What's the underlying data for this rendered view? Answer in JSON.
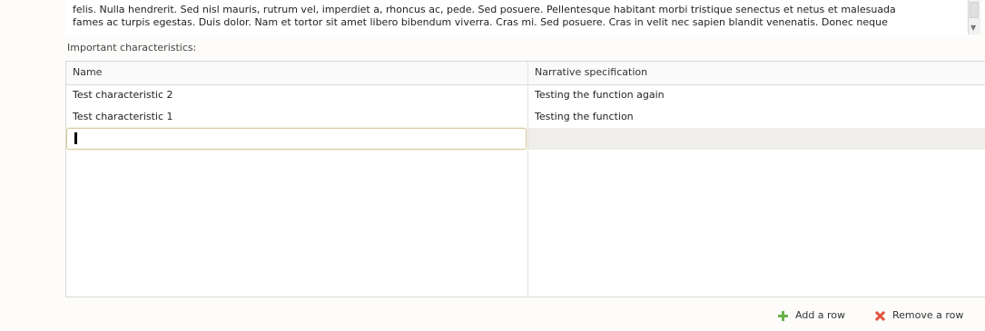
{
  "description": {
    "line1": "felis. Nulla hendrerit. Sed nisl mauris, rutrum vel, imperdiet a, rhoncus ac, pede. Sed posuere. Pellentesque habitant morbi tristique senectus et netus et malesuada",
    "line2": "fames ac turpis egestas. Duis dolor. Nam et tortor sit amet libero bibendum viverra. Cras mi. Sed posuere. Cras in velit nec sapien blandit venenatis. Donec neque",
    "scroll_arrow": "▼"
  },
  "characteristics": {
    "label": "Important characteristics:",
    "columns": [
      "Name",
      "Narrative specification"
    ],
    "rows": [
      {
        "name": "Test characteristic 2",
        "spec": "Testing the function again"
      },
      {
        "name": "Test characteristic 1",
        "spec": "Testing the function"
      }
    ],
    "new_row_value": ""
  },
  "actions": {
    "add_row": "Add a row",
    "remove_row": "Remove a row"
  },
  "colors": {
    "add_icon": "#6bb04a",
    "remove_icon": "#e2553f",
    "active_border": "#d8c9a0"
  }
}
